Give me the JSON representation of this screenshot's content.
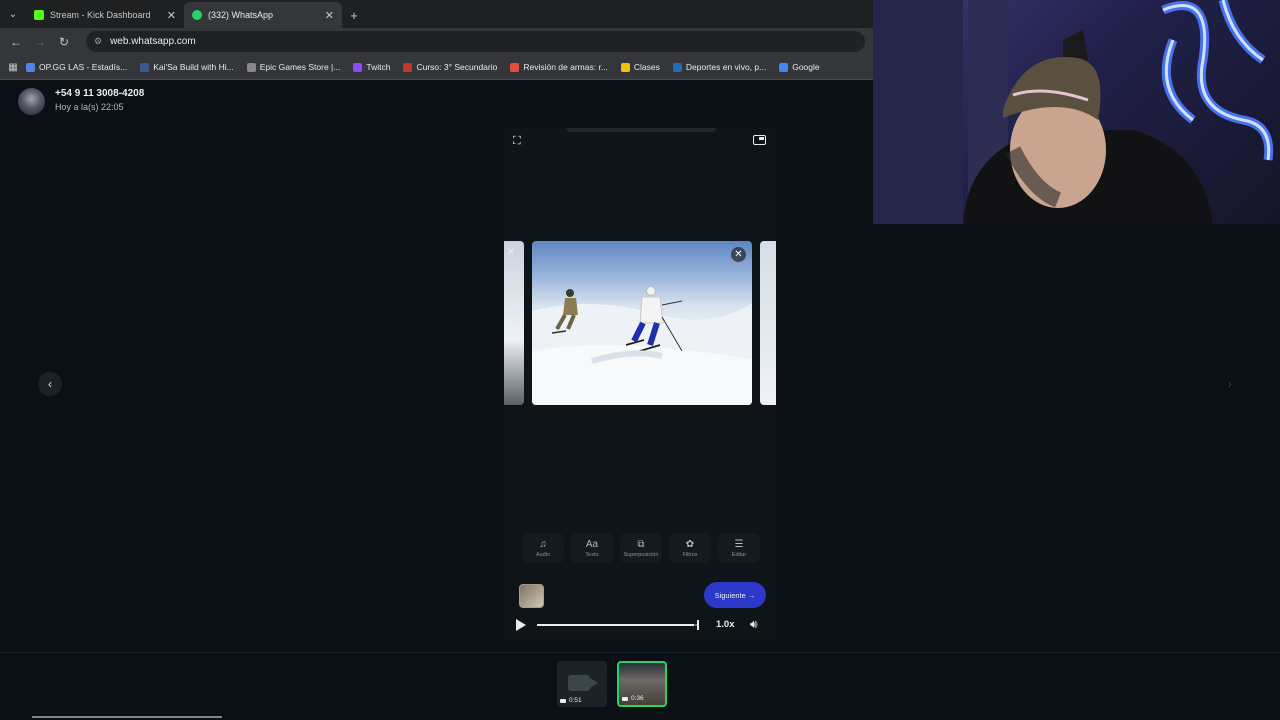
{
  "browser": {
    "tabs": [
      {
        "title": "Stream - Kick Dashboard",
        "favicon_color": "#53fc18",
        "active": false
      },
      {
        "title": "(332) WhatsApp",
        "favicon_color": "#25d366",
        "active": true
      }
    ],
    "url": "web.whatsapp.com",
    "bookmarks": [
      {
        "label": "OP.GG LAS - Estadís...",
        "color": "#5383e8"
      },
      {
        "label": "Kai'Sa Build with Hi...",
        "color": "#3c5a8a"
      },
      {
        "label": "Epic Games Store |...",
        "color": "#888888"
      },
      {
        "label": "Twitch",
        "color": "#9146ff"
      },
      {
        "label": "Curso: 3° Secundario",
        "color": "#c0392b"
      },
      {
        "label": "Revisión de armas: r...",
        "color": "#e74c3c"
      },
      {
        "label": "Clases",
        "color": "#f4c20d"
      },
      {
        "label": "Deportes en vivo, p...",
        "color": "#1f6fb5"
      },
      {
        "label": "Google",
        "color": "#4285f4"
      }
    ]
  },
  "chat": {
    "contact": "+54 9 11 3008-4208",
    "time": "Hoy a la(s) 22:05"
  },
  "editor": {
    "tools": [
      {
        "icon": "♫",
        "label": "Audio"
      },
      {
        "icon": "Aa",
        "label": "Texto"
      },
      {
        "icon": "⧉",
        "label": "Superposición"
      },
      {
        "icon": "✿",
        "label": "Filtros"
      },
      {
        "icon": "☰",
        "label": "Editar"
      }
    ],
    "next_label": "Siguiente →",
    "speed": "1.0x",
    "progress": 0.98
  },
  "strip": {
    "videos": [
      {
        "duration": "0:51",
        "selected": false
      },
      {
        "duration": "0:36",
        "selected": true
      }
    ]
  },
  "colors": {
    "accent_green": "#25d366",
    "next_button": "#2c39c8"
  }
}
